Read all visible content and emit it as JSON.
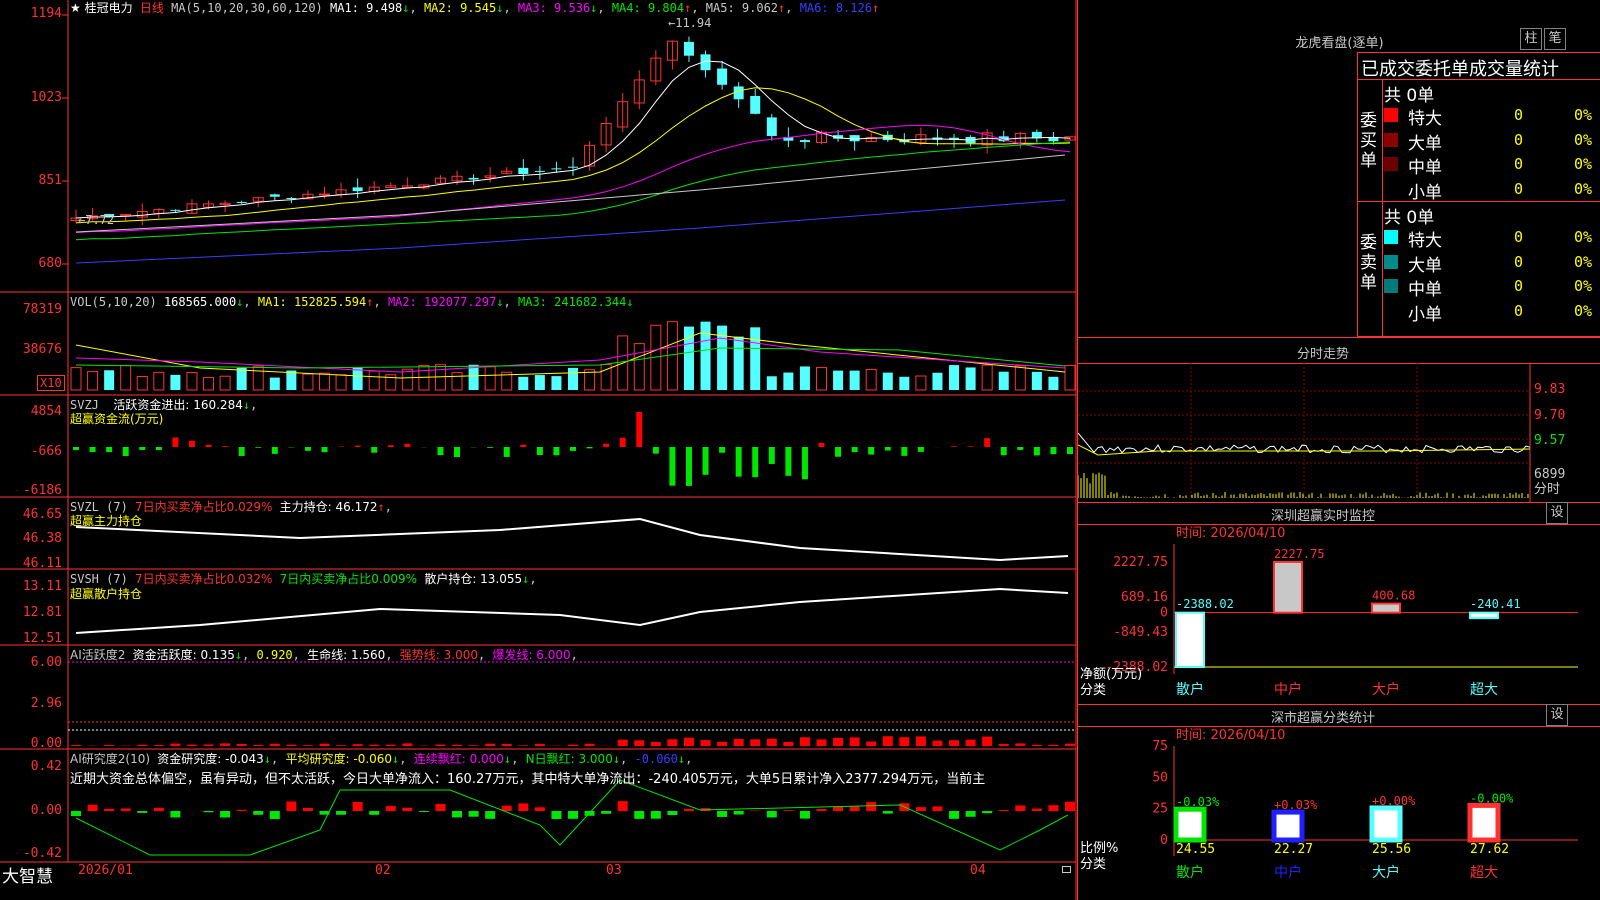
{
  "stock": {
    "name": "★ 桂冠电力",
    "period": "日线",
    "ma_label": "MA(5,10,20,30,60,120)",
    "ma1": "MA1: 9.498",
    "ma2": "MA2: 9.545",
    "ma3": "MA3: 9.536",
    "ma4": "MA4: 9.804",
    "ma5": "MA5: 9.062",
    "ma6": "MA6: 8.126",
    "high_mark": "11.94",
    "low_mark": "7.72",
    "price_axis": [
      "1194",
      "1023",
      "851",
      "680"
    ]
  },
  "vol": {
    "label": "VOL(5,10,20)",
    "value": "168565.000",
    "ma1": "MA1: 152825.594",
    "ma2": "MA2: 192077.297",
    "ma3": "MA3: 241682.344",
    "axis": [
      "78319",
      "38676"
    ],
    "unit": "X10"
  },
  "svzj": {
    "label": "SVZJ",
    "line": "活跃资金进出: 160.284",
    "sub": "超赢资金流(万元)",
    "axis": [
      "4854",
      "-666",
      "-6186"
    ]
  },
  "svzl": {
    "label": "SVZL (7)",
    "part1": "7日内买卖净占比0.029%",
    "part2": "主力持仓: 46.172",
    "sub": "超赢主力持仓",
    "axis": [
      "46.65",
      "46.38",
      "46.11"
    ]
  },
  "svsh": {
    "label": "SVSH (7)",
    "part1": "7日内买卖净占比0.032%",
    "part2": "7日内买卖净占比0.009%",
    "part3": "散户持仓: 13.055",
    "sub": "超赢散户持仓",
    "axis": [
      "13.11",
      "12.81",
      "12.51"
    ]
  },
  "ai1": {
    "label": "AI活跃度2",
    "part1": "资金活跃度: 0.135",
    "part2": "0.920",
    "part3": "生命线: 1.560",
    "part4": "强势线: 3.000",
    "part5": "爆发线: 6.000",
    "axis": [
      "6.00",
      "2.96",
      "0.00"
    ]
  },
  "ai2": {
    "label": "AI研究度2(10)",
    "part1": "资金研究度: -0.043",
    "part2": "平均研究度: -0.060",
    "part3": "连续飘红: 0.000",
    "part4": "N日飘红: 3.000",
    "part5": "-0.060",
    "comment": "近期大资金总体偏空，虽有异动，但不太活跃，今日大单净流入：160.27万元，其中特大单净流出：-240.405万元，大单5日累计净入2377.294万元，当前主",
    "axis": [
      "0.42",
      "0.00",
      "-0.42"
    ]
  },
  "time_axis": [
    "2026/01",
    "02",
    "03",
    "04"
  ],
  "brand": "大智慧",
  "right": {
    "title": "龙虎看盘(逐单)",
    "btn1": "柱",
    "btn2": "笔",
    "tabs_text": "已成交委托单成交量统计",
    "buy_label": "委买单",
    "sell_label": "委卖单",
    "buy_total": "共 0单",
    "sell_total": "共 0单",
    "buy_rows": [
      {
        "name": "特大",
        "count": "0",
        "pct": "0%",
        "color": "#ff0000"
      },
      {
        "name": "大单",
        "count": "0",
        "pct": "0%",
        "color": "#8b0000"
      },
      {
        "name": "中单",
        "count": "0",
        "pct": "0%",
        "color": "#6b0000"
      },
      {
        "name": "小单",
        "count": "0",
        "pct": "0%",
        "color": "#000000"
      }
    ],
    "sell_rows": [
      {
        "name": "特大",
        "count": "0",
        "pct": "0%",
        "color": "#00ffff"
      },
      {
        "name": "大单",
        "count": "0",
        "pct": "0%",
        "color": "#008b8b"
      },
      {
        "name": "中单",
        "count": "0",
        "pct": "0%",
        "color": "#007a7a"
      },
      {
        "name": "小单",
        "count": "0",
        "pct": "0%",
        "color": "#000000"
      }
    ],
    "intraday_title": "分时走势",
    "intraday_axis": [
      "9.83",
      "9.70",
      "9.57",
      "6899",
      "分时"
    ],
    "sz_title": "深圳超赢实时监控",
    "sz_time": "时间: 2026/04/10",
    "sz_axis": [
      "2227.75",
      "689.16",
      "0",
      "-849.43",
      "-2388.02"
    ],
    "sz_values": [
      {
        "cat": "散户",
        "value": -2388.02,
        "label": "-2388.02"
      },
      {
        "cat": "中户",
        "value": 2227.75,
        "label": "2227.75"
      },
      {
        "cat": "大户",
        "value": 400.68,
        "label": "400.68"
      },
      {
        "cat": "超大",
        "value": -240.41,
        "label": "-240.41"
      }
    ],
    "sz_ylabel": "净额(万元)",
    "sz_xlabel": "分类",
    "set_btn": "设",
    "cls_title": "深市超赢分类统计",
    "cls_time": "时间: 2026/04/10",
    "cls_axis": [
      "75",
      "50",
      "25",
      "0"
    ],
    "cls_values": [
      {
        "cat": "散户",
        "pct": 24.55,
        "change": "-0.03%",
        "label": "24.55"
      },
      {
        "cat": "中户",
        "pct": 22.27,
        "change": "+0.03%",
        "label": "22.27"
      },
      {
        "cat": "大户",
        "pct": 25.56,
        "change": "+0.00%",
        "label": "25.56"
      },
      {
        "cat": "超大",
        "pct": 27.62,
        "change": "-0.00%",
        "label": "27.62"
      }
    ],
    "cls_ylabel": "比例%",
    "cls_xlabel": "分类"
  }
}
